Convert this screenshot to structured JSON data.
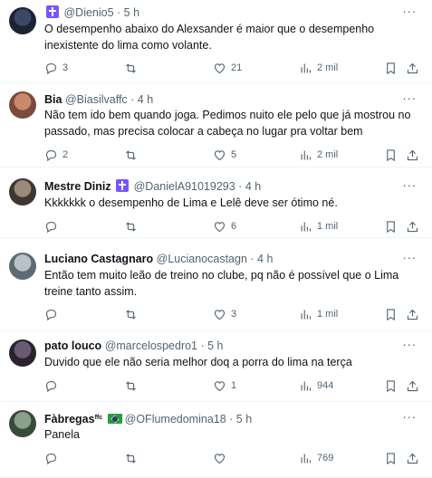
{
  "tweets": [
    {
      "name": "",
      "badge": "cross",
      "handle": "@Dienio5",
      "time": "5 h",
      "text": "O desempenho abaixo do Alexsander é maior que o desempenho inexistente do lima como volante.",
      "replies": "3",
      "retweets": "",
      "likes": "21",
      "views": "2 mil",
      "avatar_colors": [
        "#3a4a66",
        "#1c2433"
      ]
    },
    {
      "name": "Bia",
      "badge": "",
      "handle": "@Biasilvaffc",
      "time": "4 h",
      "text": "Não tem ido bem quando joga. Pedimos nuito ele pelo que já mostrou no passado, mas precisa colocar a cabeça no lugar pra voltar bem",
      "replies": "2",
      "retweets": "",
      "likes": "5",
      "views": "2 mil",
      "avatar_colors": [
        "#c98a6b",
        "#7a4a3a"
      ]
    },
    {
      "name": "Mestre Diniz",
      "badge": "cross",
      "handle": "@DanielA91019293",
      "time": "4 h",
      "text": "Kkkkkkk o desempenho de Lima e Lelê deve ser ótimo né.",
      "replies": "",
      "retweets": "",
      "likes": "6",
      "views": "1 mil",
      "avatar_colors": [
        "#9a8a7a",
        "#3e3630"
      ]
    },
    {
      "name": "Luciano Castagnaro",
      "badge": "",
      "handle": "@Lucianocastagn",
      "time": "4 h",
      "text": "Então tem muito leão de treino no clube, pq não é possível que o Lima treine tanto assim.",
      "replies": "",
      "retweets": "",
      "likes": "3",
      "views": "1 mil",
      "avatar_colors": [
        "#b9c2c8",
        "#5c6a73"
      ]
    },
    {
      "name": "pato louco",
      "badge": "",
      "handle": "@marcelospedro1",
      "time": "5 h",
      "text": "Duvido que ele não seria melhor doq a porra do lima na terça",
      "replies": "",
      "retweets": "",
      "likes": "1",
      "views": "944",
      "avatar_colors": [
        "#6b5a72",
        "#2b2230"
      ]
    },
    {
      "name": "Fàbregas",
      "name_sup": "ffc",
      "badge": "flag",
      "handle": "@OFlumedomina18",
      "time": "5 h",
      "text": "Panela",
      "replies": "",
      "retweets": "",
      "likes": "",
      "views": "769",
      "avatar_colors": [
        "#8aa08a",
        "#3a4a3a"
      ]
    }
  ],
  "icons": {
    "reply": "reply-icon",
    "retweet": "retweet-icon",
    "like": "heart-icon",
    "views": "views-icon",
    "bookmark": "bookmark-icon",
    "share": "share-icon",
    "more": "more-icon"
  },
  "more_glyph": "···",
  "separator": "·"
}
